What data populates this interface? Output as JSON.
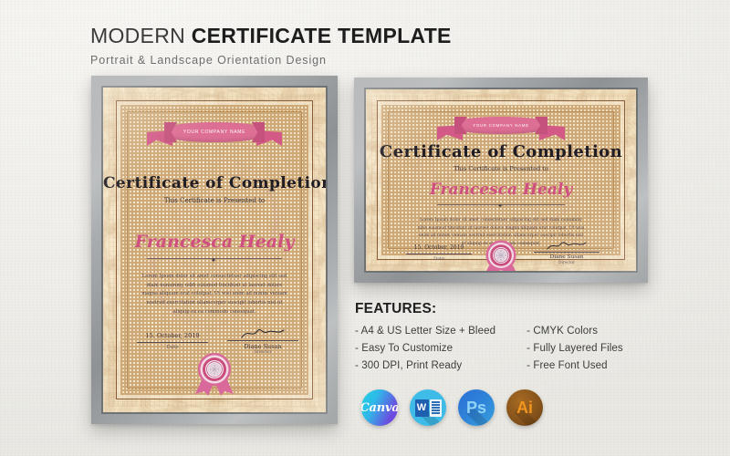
{
  "header": {
    "title_light": "MODERN ",
    "title_bold": "CERTIFICATE TEMPLATE",
    "subtitle": "Portrait & Landscape Orientation Design"
  },
  "certificate": {
    "ribbon_text": "YOUR COMPANY NAME",
    "title": "Certificate of Completion",
    "presented_to": "This Certificate is Presented to",
    "recipient": "Francesca Healy",
    "body": "Lorem Ipsum dolor sit amet consectetuer adipiscing elit sed diam nonummy nibh euismod tincidunt ut laoreet dolore magna aliquam erat volutpat. Ut wisi enim ad minim veniam nostrud exercitation ullamcorper suscipit lobortis nisl ut aliquip ex ea commodo consequat.",
    "date_value": "15. October, 2019",
    "date_label": "Date",
    "signer_name": "Diane Susan",
    "signer_role": "Director"
  },
  "features": {
    "title": "FEATURES:",
    "column_left": [
      "- A4 & US Letter Size + Bleed",
      "- Easy To Customize",
      "- 300 DPI, Print Ready"
    ],
    "column_right": [
      "- CMYK Colors",
      "- Fully Layered Files",
      "- Free Font Used"
    ]
  },
  "apps": [
    {
      "name": "canva-app-icon",
      "label": "Canva"
    },
    {
      "name": "word-app-icon",
      "label": "W"
    },
    {
      "name": "photoshop-app-icon",
      "label": "Ps"
    },
    {
      "name": "illustrator-app-icon",
      "label": "Ai"
    }
  ],
  "colors": {
    "background": "#f3f2ef",
    "frame": "#9a9d9f",
    "paper": "#fdf6e4",
    "guilloche": "#c19a6b",
    "accent_pink": "#dd6f95",
    "accent_pink_dark": "#cf4f80",
    "title_dark": "#1d1d1d"
  }
}
